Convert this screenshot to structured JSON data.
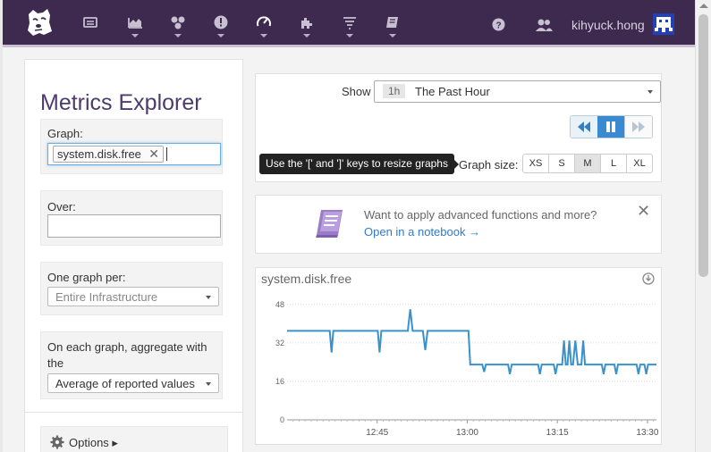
{
  "nav": {
    "username": "kihyuck.hong",
    "icons": [
      "dashboard-icon",
      "metrics-icon",
      "infrastructure-icon",
      "monitors-icon",
      "apm-icon",
      "integrations-icon",
      "logs-icon",
      "notebooks-icon",
      "help-icon",
      "team-icon"
    ]
  },
  "sidebar": {
    "title": "Metrics Explorer",
    "graph_label": "Graph:",
    "graph_tag": "system.disk.free",
    "graph_tag_remove": "✕",
    "over_label": "Over:",
    "over_value": "",
    "per_label": "One graph per:",
    "per_value": "Entire Infrastructure",
    "aggregate_label": "On each graph, aggregate with the",
    "aggregate_value": "Average of reported values",
    "options_label": "Options ▸"
  },
  "controls": {
    "show_label": "Show",
    "time_badge": "1h",
    "time_value": "The Past Hour",
    "tooltip": "Use the '[' and ']' keys to resize graphs",
    "graph_size_label": "Graph size:",
    "sizes": [
      "XS",
      "S",
      "M",
      "L",
      "XL"
    ],
    "active_size": "M"
  },
  "notebook": {
    "text": "Want to apply advanced functions and more?",
    "link": "Open in a notebook →",
    "close": "✕"
  },
  "chart_data": {
    "type": "line",
    "title": "system.disk.free",
    "yticks": [
      0,
      16,
      32,
      48
    ],
    "ylim": [
      0,
      52
    ],
    "xticks": [
      "12:45",
      "13:00",
      "13:15",
      "13:30"
    ],
    "xtick_minutes": [
      45,
      60,
      75,
      90
    ],
    "xlim": [
      30,
      91.5
    ],
    "series": [
      {
        "color": "#3a92cc",
        "x": [
          30,
          37.1,
          37.4,
          37.7,
          45.1,
          45.4,
          45.7,
          50.1,
          50.5,
          50.9,
          52.6,
          53,
          53.4,
          60.2,
          60.5,
          62.5,
          62.8,
          63.1,
          66.8,
          67.1,
          67.4,
          71.8,
          72.1,
          72.4,
          74.4,
          74.7,
          75,
          75.8,
          76.1,
          76.4,
          76.7,
          77,
          77.3,
          77.6,
          78,
          78.4,
          79,
          79.3,
          79.6,
          82.4,
          82.7,
          83,
          84.5,
          84.8,
          85.1,
          88.2,
          88.5,
          88.8,
          89.5,
          89.8,
          90.1,
          91.5
        ],
        "y": [
          37,
          37,
          28,
          37,
          37,
          28,
          37,
          37,
          46,
          37,
          37,
          29,
          37,
          37,
          23,
          23,
          20,
          23,
          23,
          19,
          23,
          23,
          19,
          23,
          23,
          19,
          23,
          23,
          33,
          23,
          23,
          33,
          23,
          23,
          33,
          23,
          23,
          33,
          23,
          23,
          19,
          23,
          23,
          19,
          23,
          23,
          19,
          23,
          23,
          19,
          23,
          23
        ]
      }
    ]
  }
}
